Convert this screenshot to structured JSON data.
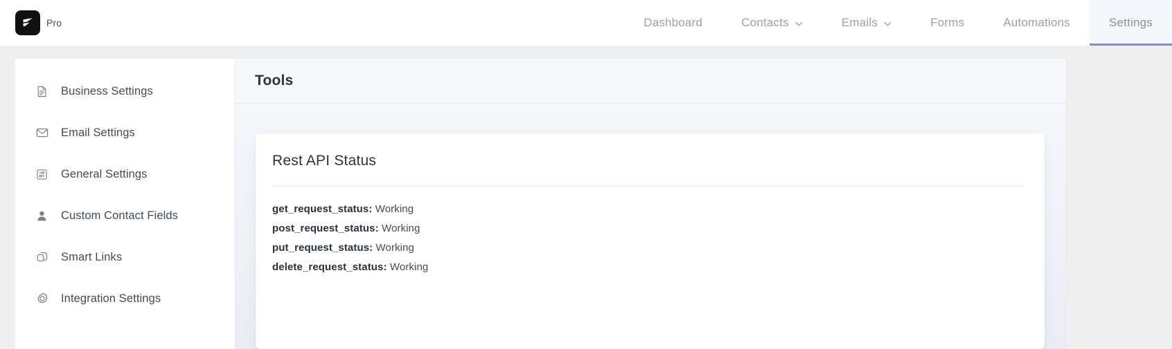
{
  "header": {
    "brand": {
      "logo_icon": "flashy-f-logo-icon",
      "label": "Pro"
    },
    "nav": [
      {
        "label": "Dashboard",
        "has_caret": false,
        "active": false
      },
      {
        "label": "Contacts",
        "has_caret": true,
        "active": false
      },
      {
        "label": "Emails",
        "has_caret": true,
        "active": false
      },
      {
        "label": "Forms",
        "has_caret": false,
        "active": false
      },
      {
        "label": "Automations",
        "has_caret": false,
        "active": false
      },
      {
        "label": "Settings",
        "has_caret": false,
        "active": true
      }
    ],
    "active_tab": "Settings",
    "active_underline_color": "#8d86d4",
    "active_tab_bg": "#f4f8fc"
  },
  "sidebar": {
    "items": [
      {
        "label": "Business Settings",
        "icon": "document-icon"
      },
      {
        "label": "Email Settings",
        "icon": "envelope-icon"
      },
      {
        "label": "General Settings",
        "icon": "sliders-panel-icon"
      },
      {
        "label": "Custom Contact Fields",
        "icon": "person-icon"
      },
      {
        "label": "Smart Links",
        "icon": "link-chain-icon"
      },
      {
        "label": "Integration Settings",
        "icon": "gear-icon"
      }
    ]
  },
  "main": {
    "title": "Tools",
    "card": {
      "title": "Rest API Status",
      "rows": [
        {
          "key": "get_request_status:",
          "value": "Working"
        },
        {
          "key": "post_request_status:",
          "value": "Working"
        },
        {
          "key": "put_request_status:",
          "value": "Working"
        },
        {
          "key": "delete_request_status:",
          "value": "Working"
        }
      ]
    }
  }
}
